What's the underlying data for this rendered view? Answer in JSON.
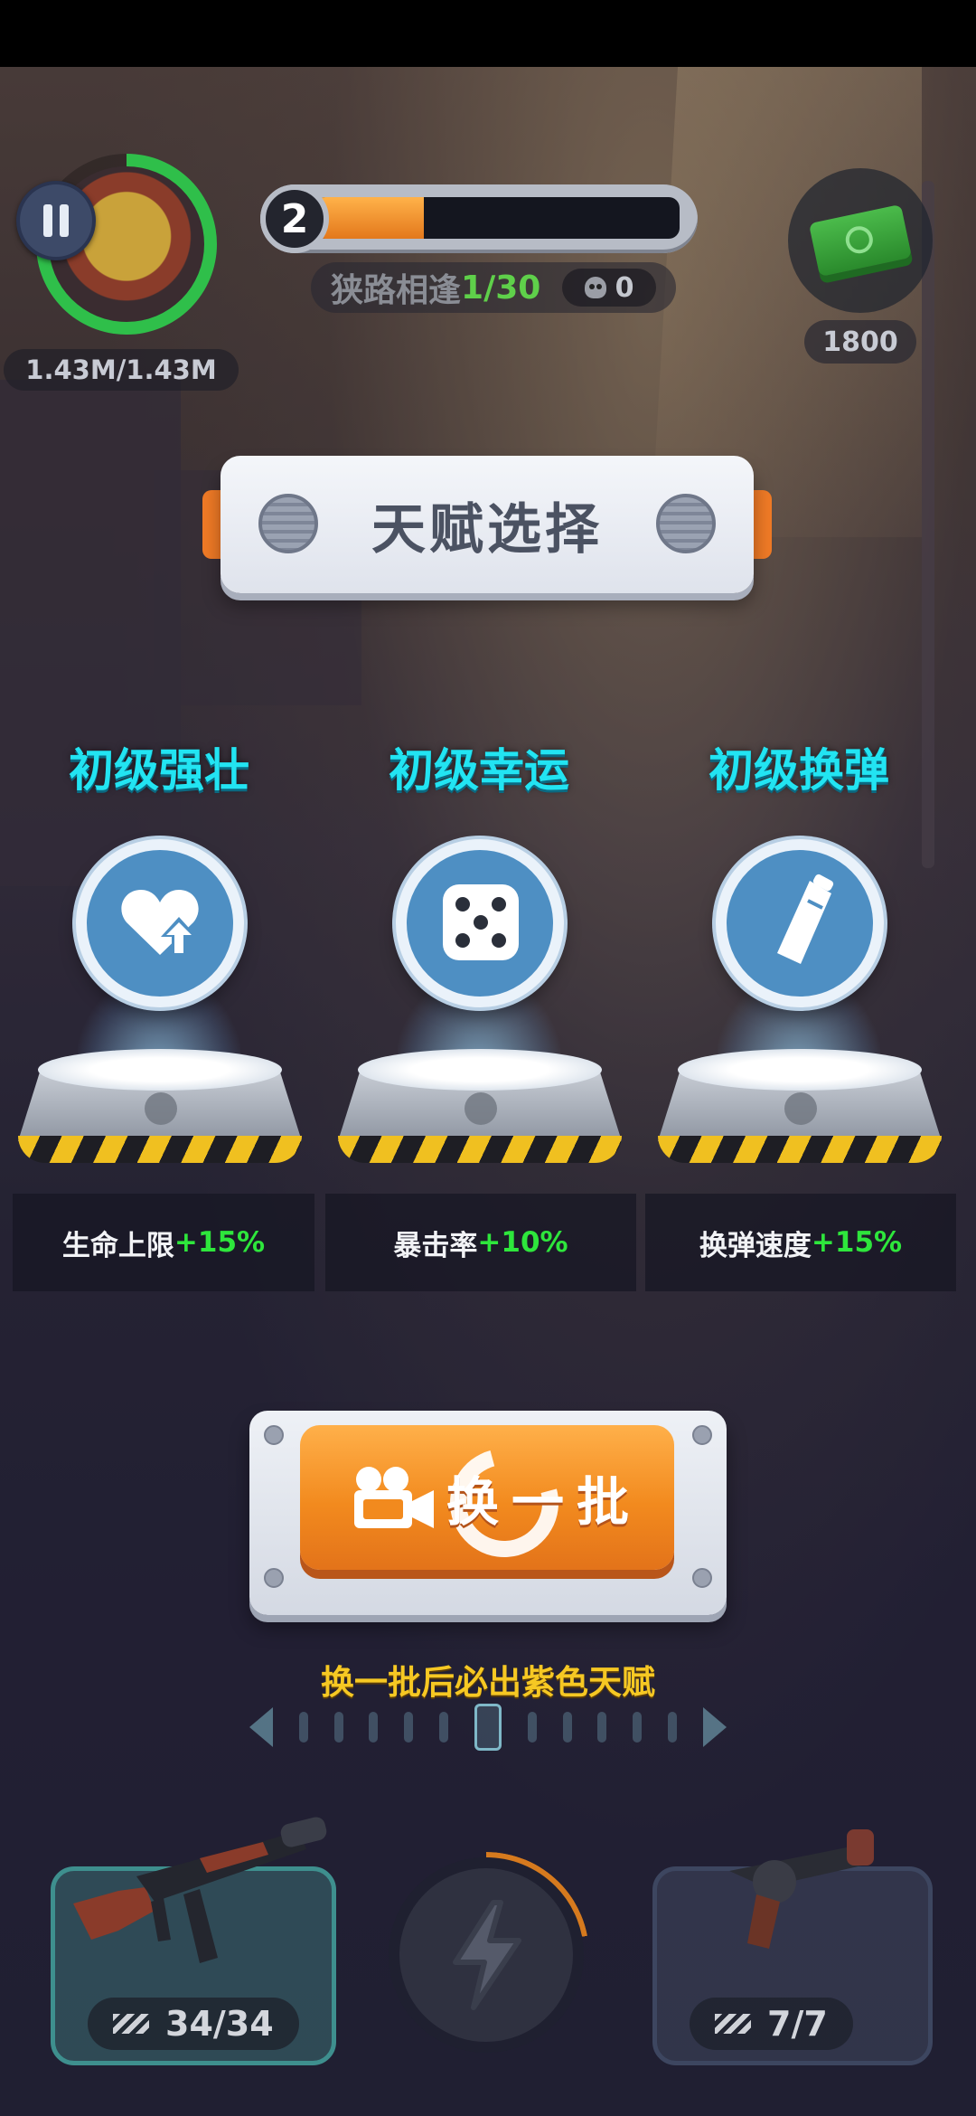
{
  "hud": {
    "player_hp": "1.43M/1.43M",
    "hp_fraction": 0.78,
    "level": "2",
    "level_progress": 0.3,
    "mission_name": "狭路相逢",
    "mission_progress": "1/30",
    "kill_count": "0",
    "cash": "1800"
  },
  "dialog": {
    "title": "天赋选择",
    "talents": [
      {
        "name": "初级强壮",
        "icon": "heart-up-icon",
        "stat_label": "生命上限",
        "stat_value": "+15%"
      },
      {
        "name": "初级幸运",
        "icon": "dice-icon",
        "stat_label": "暴击率",
        "stat_value": "+10%"
      },
      {
        "name": "初级换弹",
        "icon": "magazine-icon",
        "stat_label": "换弹速度",
        "stat_value": "+15%"
      }
    ],
    "refresh_label": "换一批",
    "refresh_hint": "换一批后必出紫色天赋"
  },
  "weapons": {
    "primary_ammo": "34/34",
    "secondary_ammo": "7/7"
  },
  "colors": {
    "talent_name": "#22e4f2",
    "stat_value": "#2ee63c",
    "hint": "#f6c823",
    "refresh_button": "#f28a1e"
  }
}
